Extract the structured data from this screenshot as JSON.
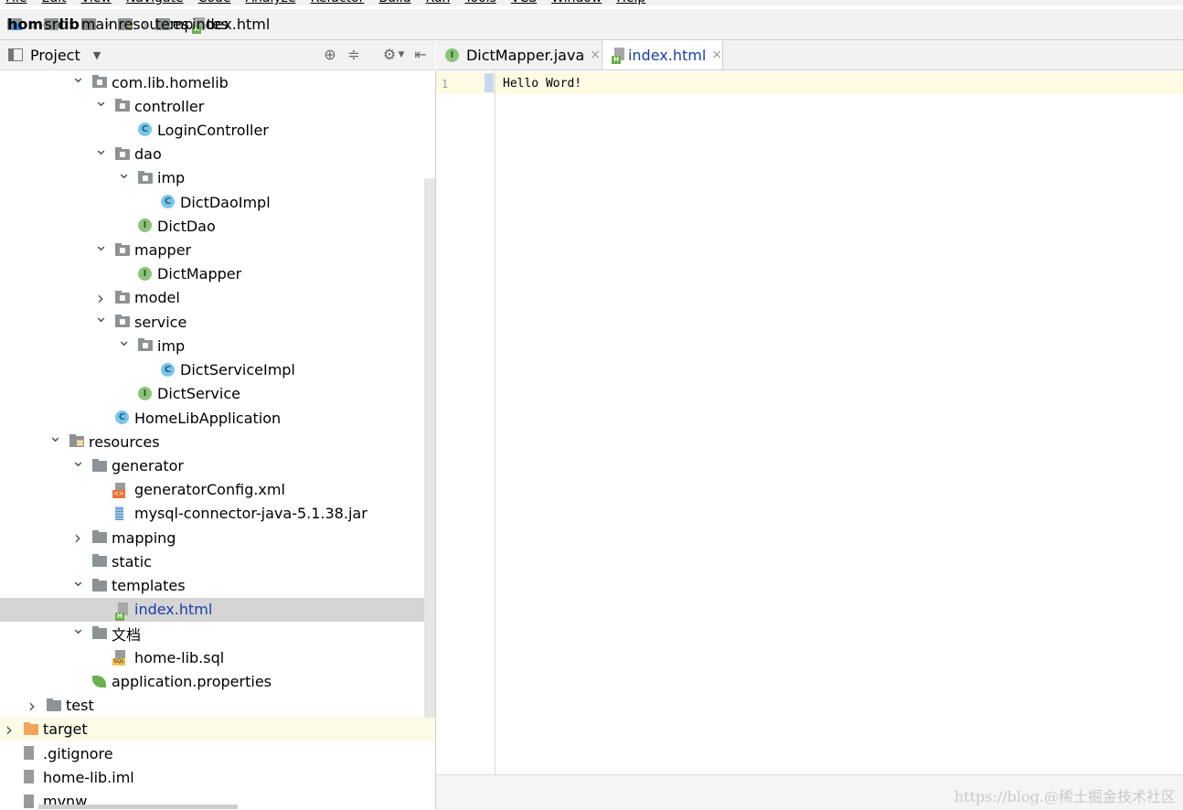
{
  "menu": [
    "File",
    "Edit",
    "View",
    "Navigate",
    "Code",
    "Analyze",
    "Refactor",
    "Build",
    "Run",
    "Tools",
    "VCS",
    "Window",
    "Help"
  ],
  "breadcrumb": [
    {
      "label": "home-lib",
      "icon": "project-folder-icon"
    },
    {
      "label": "src",
      "icon": "folder-icon"
    },
    {
      "label": "main",
      "icon": "folder-icon"
    },
    {
      "label": "resources",
      "icon": "resources-folder-icon"
    },
    {
      "label": "templates",
      "icon": "folder-icon"
    },
    {
      "label": "index.html",
      "icon": "html-file-icon"
    }
  ],
  "project_panel": {
    "title": "Project",
    "tree": [
      {
        "label": "com.lib.homelib",
        "icon": "package",
        "arrow": "down"
      },
      {
        "label": "controller",
        "icon": "package",
        "arrow": "down"
      },
      {
        "label": "LoginController",
        "icon": "class",
        "arrow": ""
      },
      {
        "label": "dao",
        "icon": "package",
        "arrow": "down"
      },
      {
        "label": "imp",
        "icon": "package",
        "arrow": "down"
      },
      {
        "label": "DictDaoImpl",
        "icon": "class",
        "arrow": ""
      },
      {
        "label": "DictDao",
        "icon": "interface",
        "arrow": ""
      },
      {
        "label": "mapper",
        "icon": "package",
        "arrow": "down"
      },
      {
        "label": "DictMapper",
        "icon": "interface",
        "arrow": ""
      },
      {
        "label": "model",
        "icon": "package",
        "arrow": "right"
      },
      {
        "label": "service",
        "icon": "package",
        "arrow": "down"
      },
      {
        "label": "imp",
        "icon": "package",
        "arrow": "down"
      },
      {
        "label": "DictServiceImpl",
        "icon": "class",
        "arrow": ""
      },
      {
        "label": "DictService",
        "icon": "interface",
        "arrow": ""
      },
      {
        "label": "HomeLibApplication",
        "icon": "class",
        "arrow": ""
      },
      {
        "label": "resources",
        "icon": "resources-folder",
        "arrow": "down"
      },
      {
        "label": "generator",
        "icon": "folder",
        "arrow": "down"
      },
      {
        "label": "generatorConfig.xml",
        "icon": "xml-file",
        "arrow": ""
      },
      {
        "label": "mysql-connector-java-5.1.38.jar",
        "icon": "jar-file",
        "arrow": ""
      },
      {
        "label": "mapping",
        "icon": "folder",
        "arrow": "right"
      },
      {
        "label": "static",
        "icon": "folder",
        "arrow": ""
      },
      {
        "label": "templates",
        "icon": "folder",
        "arrow": "down"
      },
      {
        "label": "index.html",
        "icon": "html-file",
        "arrow": "",
        "selected": true
      },
      {
        "label": "文档",
        "icon": "folder",
        "arrow": "down"
      },
      {
        "label": "home-lib.sql",
        "icon": "sql-file",
        "arrow": ""
      },
      {
        "label": "application.properties",
        "icon": "properties-file",
        "arrow": ""
      },
      {
        "label": "test",
        "icon": "folder",
        "arrow": "right"
      },
      {
        "label": "target",
        "icon": "excluded-folder",
        "arrow": "right",
        "highlight": true
      },
      {
        "label": ".gitignore",
        "icon": "text-file",
        "arrow": ""
      },
      {
        "label": "home-lib.iml",
        "icon": "iml-file",
        "arrow": ""
      },
      {
        "label": "mvnw",
        "icon": "text-file",
        "arrow": ""
      }
    ]
  },
  "editor": {
    "tabs": [
      {
        "label": "DictMapper.java",
        "active": false
      },
      {
        "label": "index.html",
        "active": true
      }
    ],
    "line_number": "1",
    "code": "Hello Word!"
  },
  "watermark": "https://blog.@稀土掘金技术社区",
  "colors": {
    "selection": "#d5d5d5",
    "accent": "#1a3fa8",
    "current_line": "#fffae3"
  }
}
